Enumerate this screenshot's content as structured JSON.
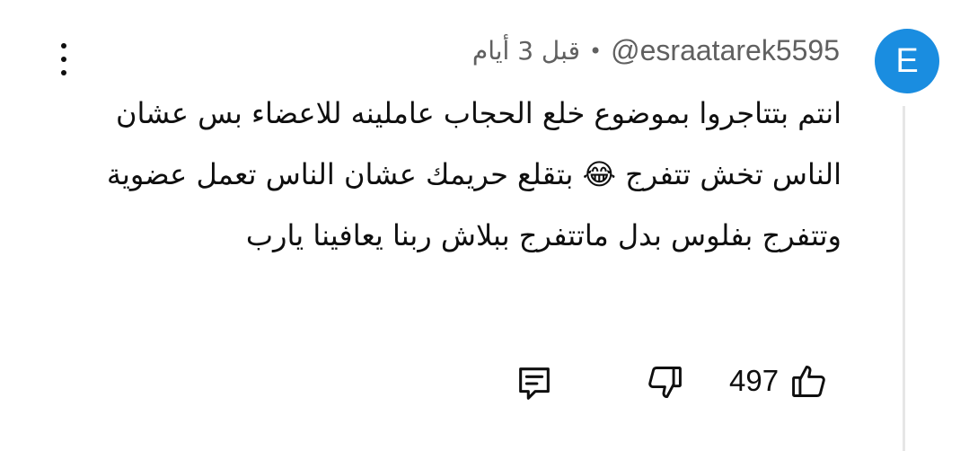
{
  "author": {
    "avatar_letter": "E",
    "handle": "@esraatarek5595",
    "separator": "•",
    "time_ago": "قبل 3 أيام"
  },
  "comment": {
    "text": "انتم بتتاجروا بموضوع خلع الحجاب عاملينه للاعضاء بس عشان الناس تخش تتفرج 😂 بتقلع حريمك عشان الناس تعمل عضوية وتتفرج بفلوس بدل ماتتفرج ببلاش ربنا يعافينا يارب"
  },
  "actions": {
    "like_count": "497",
    "like_icon": "thumbs-up-icon",
    "dislike_icon": "thumbs-down-icon",
    "reply_icon": "reply-comment-icon",
    "more_icon": "more-vertical-icon"
  },
  "colors": {
    "avatar_bg": "#1a8de0",
    "meta_text": "#606060",
    "body_text": "#0f0f0f"
  }
}
